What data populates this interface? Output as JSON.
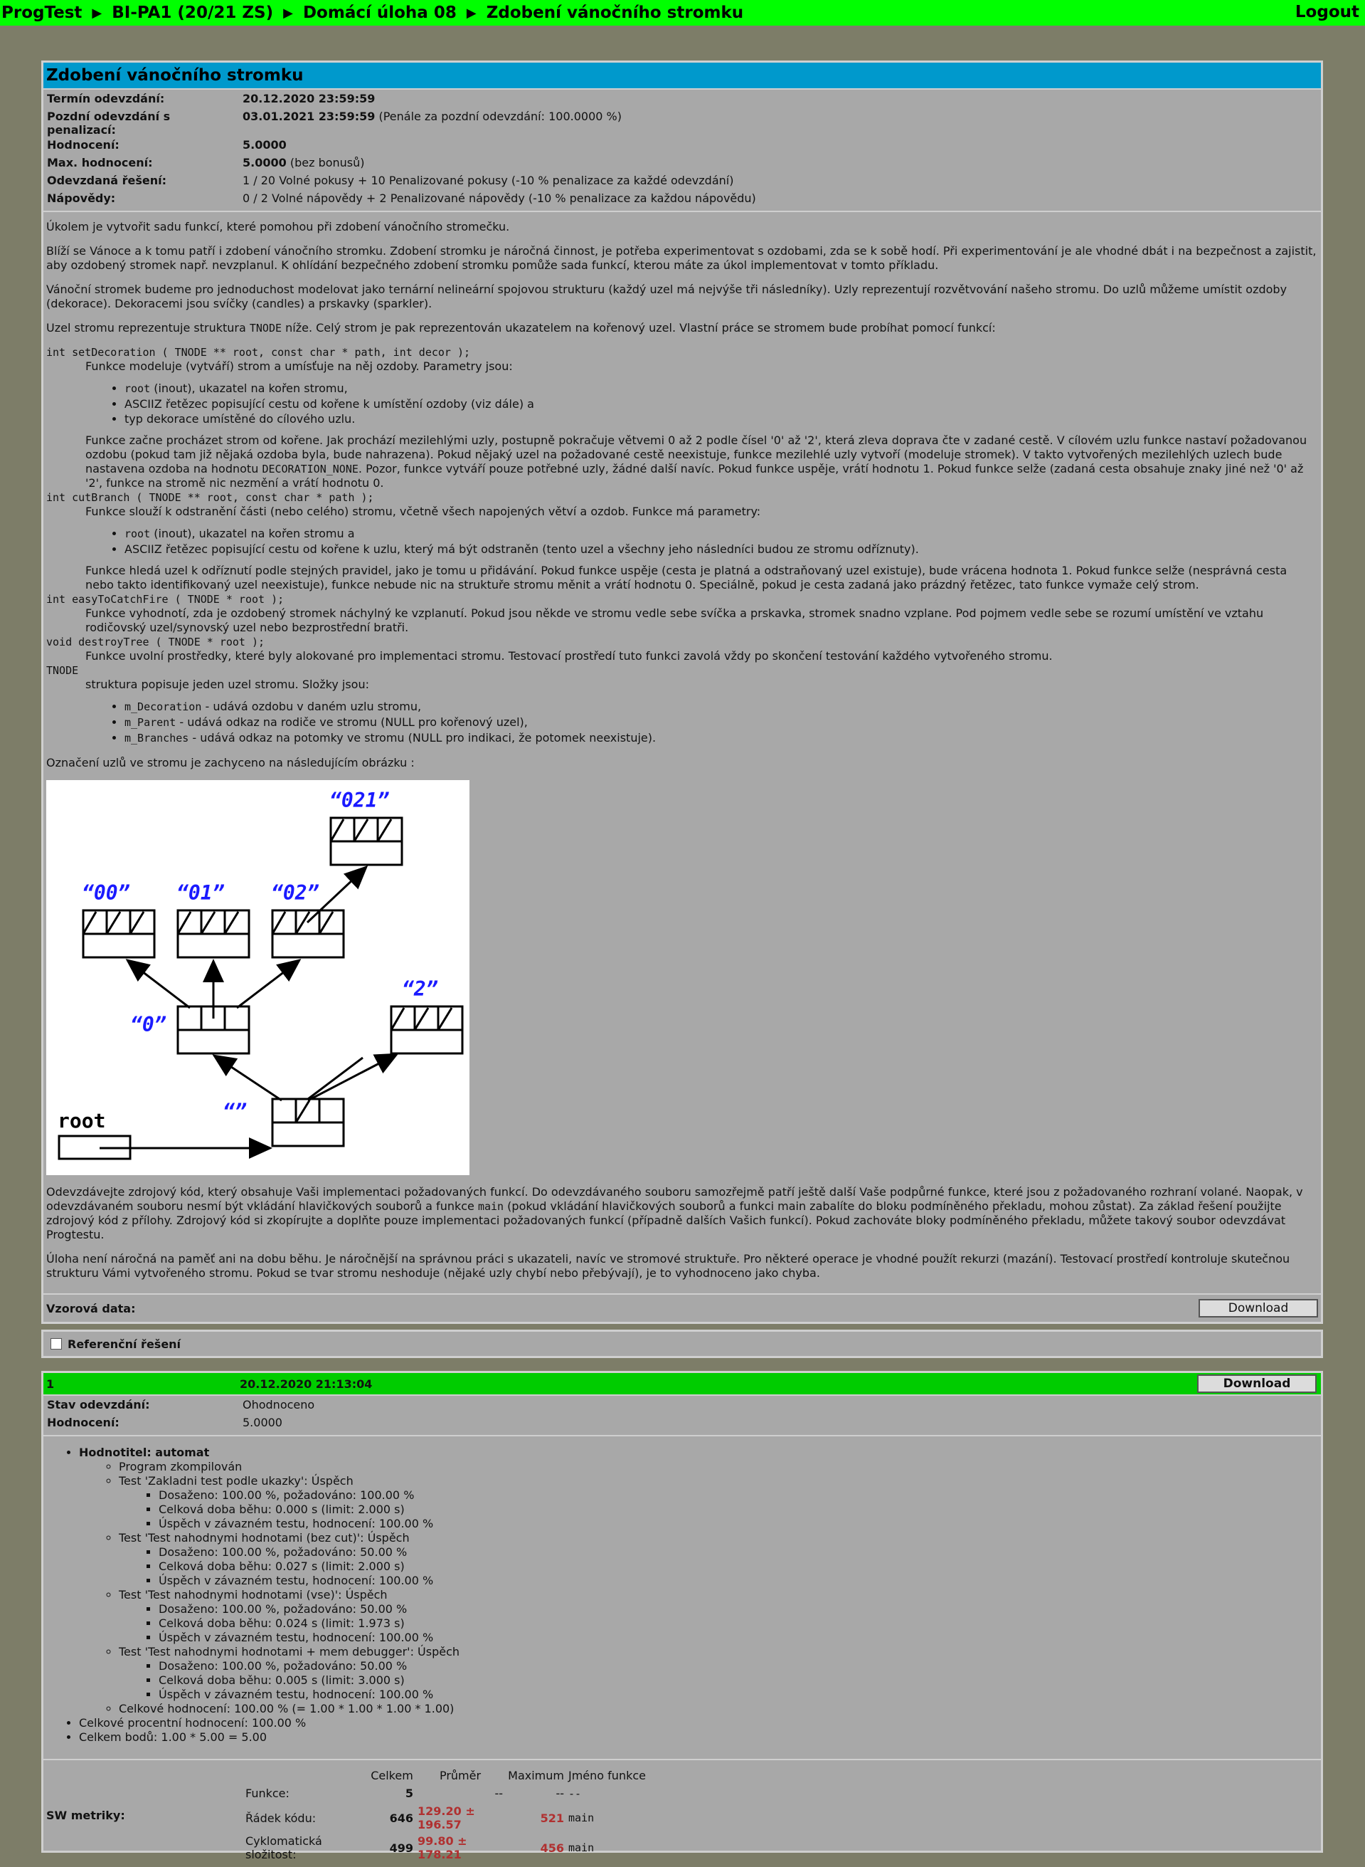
{
  "topbar": {
    "breadcrumb": [
      "ProgTest",
      "BI-PA1 (20/21 ZS)",
      "Domácí úloha 08",
      "Zdobení vánočního stromku"
    ],
    "logout": "Logout"
  },
  "task": {
    "title": "Zdobení vánočního stromku",
    "meta": [
      {
        "label": "Termín odevzdání:",
        "value": "20.12.2020 23:59:59",
        "extra": ""
      },
      {
        "label": "Pozdní odevzdání s penalizací:",
        "value": "03.01.2021 23:59:59",
        "extra": " (Penále za pozdní odevzdání: 100.0000 %)"
      },
      {
        "label": "Hodnocení:",
        "value": "5.0000",
        "extra": ""
      },
      {
        "label": "Max. hodnocení:",
        "value": "5.0000",
        "extra": " (bez bonusů)"
      },
      {
        "label": "Odevzdaná řešení:",
        "value": "",
        "extra": "1 / 20 Volné pokusy + 10 Penalizované pokusy (-10 % penalizace za každé odevzdání)"
      },
      {
        "label": "Nápovědy:",
        "value": "",
        "extra": "0 / 2 Volné nápovědy + 2 Penalizované nápovědy (-10 % penalizace za každou nápovědu)"
      }
    ],
    "p1": "Úkolem je vytvořit sadu funkcí, které pomohou při zdobení vánočního stromečku.",
    "p2": "Blíží se Vánoce a k tomu patří i zdobení vánočního stromku. Zdobení stromku je náročná činnost, je potřeba experimentovat s ozdobami, zda se k sobě hodí. Při experimentování je ale vhodné dbát i na bezpečnost a zajistit, aby ozdobený stromek např. nevzplanul. K ohlídání bezpečného zdobení stromku pomůže sada funkcí, kterou máte za úkol implementovat v tomto příkladu.",
    "p3": "Vánoční stromek budeme pro jednoduchost modelovat jako ternární nelineární spojovou strukturu (každý uzel má nejvýše tři následníky). Uzly reprezentují rozvětvování našeho stromu. Do uzlů můžeme umístit ozdoby (dekorace). Dekoracemi jsou svíčky (candles) a prskavky (sparkler).",
    "p4a": "Uzel stromu reprezentuje struktura ",
    "p4code": "TNODE",
    "p4b": " níže. Celý strom je pak reprezentován ukazatelem na kořenový uzel. Vlastní práce se stromem bude probíhat pomocí funkcí:",
    "f1_sig": "int setDecoration ( TNODE ** root, const char * path, int decor );",
    "f1_intro": "Funkce modeluje (vytváří) strom a umísťuje na něj ozdoby. Parametry jsou:",
    "f1_items": [
      {
        "code": "root",
        "text": " (inout), ukazatel na kořen stromu,"
      },
      {
        "code": "",
        "text": "ASCIIZ řetězec popisující cestu od kořene k umístění ozdoby (viz dále) a"
      },
      {
        "code": "",
        "text": "typ dekorace umístěné do cílového uzlu."
      }
    ],
    "f1_body_a": "Funkce začne procházet strom od kořene. Jak prochází mezilehlými uzly, postupně pokračuje větvemi 0 až 2 podle čísel '0' až '2', která zleva doprava čte v zadané cestě. V cílovém uzlu funkce nastaví požadovanou ozdobu (pokud tam již nějaká ozdoba byla, bude nahrazena). Pokud nějaký uzel na požadované cestě neexistuje, funkce mezilehlé uzly vytvoří (modeluje stromek). V takto vytvořených mezilehlých uzlech bude nastavena ozdoba na hodnotu ",
    "f1_body_code": "DECORATION_NONE",
    "f1_body_b": ". Pozor, funkce vytváří pouze potřebné uzly, žádné další navíc. Pokud funkce uspěje, vrátí hodnotu 1. Pokud funkce selže (zadaná cesta obsahuje znaky jiné než '0' až '2', funkce na stromě nic nezmění a vrátí hodnotu 0.",
    "f2_sig": "int cutBranch ( TNODE ** root, const char * path );",
    "f2_intro": "Funkce slouží k odstranění části (nebo celého) stromu, včetně všech napojených větví a ozdob. Funkce má parametry:",
    "f2_items": [
      {
        "code": "root",
        "text": " (inout), ukazatel na kořen stromu a"
      },
      {
        "code": "",
        "text": "ASCIIZ řetězec popisující cestu od kořene k uzlu, který má být odstraněn (tento uzel a všechny jeho následníci budou ze stromu odříznuty)."
      }
    ],
    "f2_body": "Funkce hledá uzel k odříznutí podle stejných pravidel, jako je tomu u přidávání. Pokud funkce uspěje (cesta je platná a odstraňovaný uzel existuje), bude vrácena hodnota 1. Pokud funkce selže (nesprávná cesta nebo takto identifikovaný uzel neexistuje), funkce nebude nic na struktuře stromu měnit a vrátí hodnotu 0. Speciálně, pokud je cesta zadaná jako prázdný řetězec, tato funkce vymaže celý strom.",
    "f3_sig": "int easyToCatchFire ( TNODE * root );",
    "f3_body": "Funkce vyhodnotí, zda je ozdobený stromek náchylný ke vzplanutí. Pokud jsou někde ve stromu vedle sebe svíčka a prskavka, stromek snadno vzplane. Pod pojmem vedle sebe se rozumí umístění ve vztahu rodičovský uzel/synovský uzel nebo bezprostřední bratři.",
    "f4_sig": "void destroyTree ( TNODE * root );",
    "f4_body": "Funkce uvolní prostředky, které byly alokované pro implementaci stromu. Testovací prostředí tuto funkci zavolá vždy po skončení testování každého vytvořeného stromu.",
    "t_sig": "TNODE",
    "t_intro": "struktura popisuje jeden uzel stromu. Složky jsou:",
    "t_items": [
      {
        "code": "m_Decoration",
        "text": " - udává ozdobu v daném uzlu stromu,"
      },
      {
        "code": "m_Parent",
        "text": " - udává odkaz na rodiče ve stromu (NULL pro kořenový uzel),"
      },
      {
        "code": "m_Branches",
        "text": " - udává odkaz na potomky ve stromu (NULL pro indikaci, že potomek neexistuje)."
      }
    ],
    "fig_caption": "Označení uzlů ve stromu je zachyceno na následujícím obrázku :",
    "fig_labels": {
      "n021": "“021”",
      "n00": "“00”",
      "n01": "“01”",
      "n02": "“02”",
      "n0": "“0”",
      "n2": "“2”",
      "root": "root",
      "empty": "“”"
    },
    "p5a": "Odevzdávejte zdrojový kód, který obsahuje Vaši implementaci požadovaných funkcí. Do odevzdávaného souboru samozřejmě patří ještě další Vaše podpůrné funkce, které jsou z požadovaného rozhraní volané. Naopak, v odevzdávaném souboru nesmí být vkládání hlavičkových souborů a funkce ",
    "p5code": "main",
    "p5b": " (pokud vkládání hlavičkových souborů a funkci main zabalíte do bloku podmíněného překladu, mohou zůstat). Za základ řešení použijte zdrojový kód z přílohy. Zdrojový kód si zkopírujte a doplňte pouze implementaci požadovaných funkcí (případně dalších Vašich funkcí). Pokud zachováte bloky podmíněného překladu, můžete takový soubor odevzdávat Progtestu.",
    "p6": "Úloha není náročná na paměť ani na dobu běhu. Je náročnější na správnou práci s ukazateli, navíc ve stromové struktuře. Pro některé operace je vhodné použít rekurzi (mazání). Testovací prostředí kontroluje skutečnou strukturu Vámi vytvořeného stromu. Pokud se tvar stromu neshoduje (nějaké uzly chybí nebo přebývají), je to vyhodnoceno jako chyba.",
    "sample_label": "Vzorová data:",
    "download": "Download"
  },
  "reference": {
    "label": "Referenční řešení"
  },
  "submission": {
    "number": "1",
    "date": "20.12.2020 21:13:04",
    "download": "Download",
    "state_label": "Stav odevzdání:",
    "state": "Ohodnoceno",
    "score_label": "Hodnocení:",
    "score": "5.0000",
    "evaluator": "Hodnotitel: automat",
    "compiled": "Program zkompilován",
    "tests": [
      {
        "name": "Test 'Zakladni test podle ukazky': Úspěch",
        "lines": [
          "Dosaženo: 100.00 %, požadováno: 100.00 %",
          "Celková doba běhu: 0.000 s (limit: 2.000 s)",
          "Úspěch v závazném testu, hodnocení: 100.00 %"
        ]
      },
      {
        "name": "Test 'Test nahodnymi hodnotami (bez cut)': Úspěch",
        "lines": [
          "Dosaženo: 100.00 %, požadováno: 50.00 %",
          "Celková doba běhu: 0.027 s (limit: 2.000 s)",
          "Úspěch v závazném testu, hodnocení: 100.00 %"
        ]
      },
      {
        "name": "Test 'Test nahodnymi hodnotami (vse)': Úspěch",
        "lines": [
          "Dosaženo: 100.00 %, požadováno: 50.00 %",
          "Celková doba běhu: 0.024 s (limit: 1.973 s)",
          "Úspěch v závazném testu, hodnocení: 100.00 %"
        ]
      },
      {
        "name": "Test 'Test nahodnymi hodnotami + mem debugger': Úspěch",
        "lines": [
          "Dosaženo: 100.00 %, požadováno: 50.00 %",
          "Celková doba běhu: 0.005 s (limit: 3.000 s)",
          "Úspěch v závazném testu, hodnocení: 100.00 %"
        ]
      }
    ],
    "overall": "Celkové hodnocení: 100.00 % (= 1.00 * 1.00 * 1.00 * 1.00)",
    "total_percent": "Celkové procentní hodnocení: 100.00 %",
    "total_points": "Celkem bodů: 1.00 * 5.00 = 5.00",
    "sw_label": "SW metriky:",
    "sw_headers": [
      "Celkem",
      "Průměr",
      "Maximum",
      "Jméno funkce"
    ],
    "sw_rows": [
      {
        "name": "Funkce:",
        "total": "5",
        "avg": "--",
        "max": "--",
        "fn": "--"
      },
      {
        "name": "Řádek kódu:",
        "total": "646",
        "avg": "129.20 ± 196.57",
        "max": "521",
        "fn": "main"
      },
      {
        "name": "Cyklomatická složitost:",
        "total": "499",
        "avg": "99.80 ± 178.21",
        "max": "456",
        "fn": "main"
      }
    ]
  },
  "colors": {
    "topbar": "#00ff00",
    "title_bar": "#0099cc",
    "submission_bar": "#00cc00",
    "page_bg": "#7d7d68",
    "panel_bg": "#a8a8a8",
    "label_blue": "#1a1aff"
  }
}
